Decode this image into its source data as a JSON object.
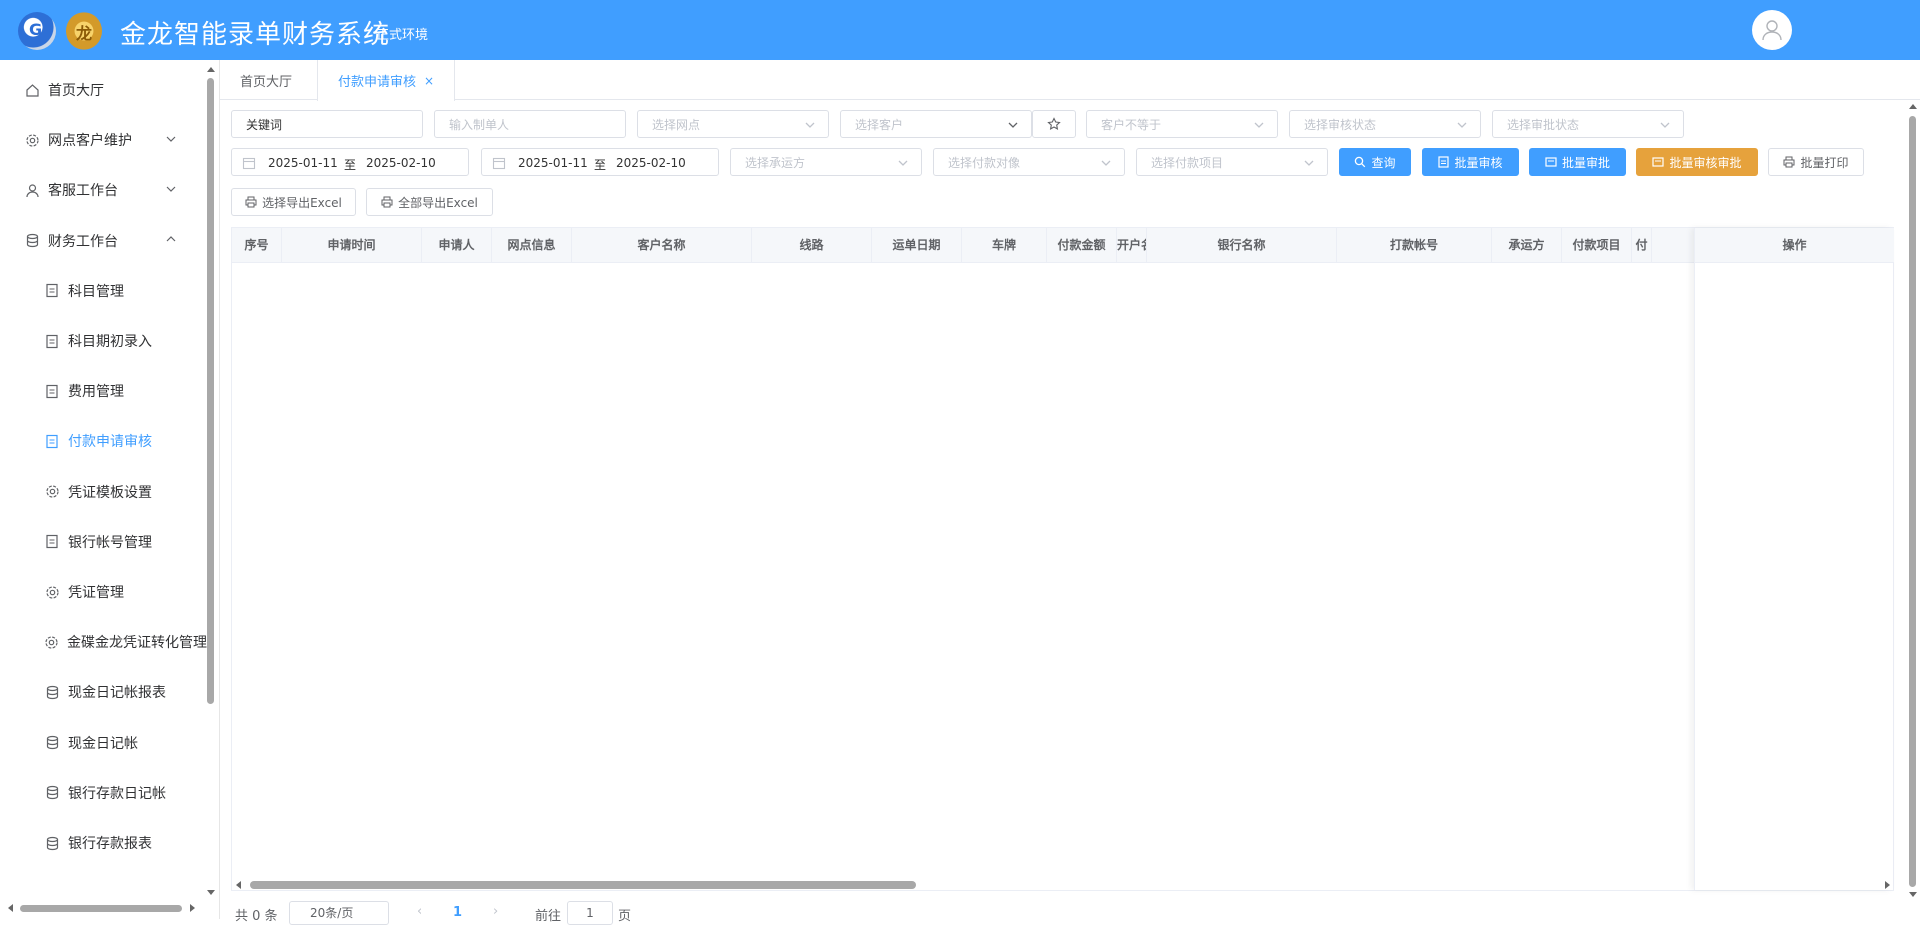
{
  "header": {
    "logo_text": "G",
    "logo2_text": "龙",
    "title": "金龙智能录单财务系统",
    "env": "正式环境"
  },
  "sidebar": {
    "items": [
      {
        "label": "首页大厅",
        "icon": "home-icon",
        "level": "top"
      },
      {
        "label": "网点客户维护",
        "icon": "gear-icon",
        "level": "top",
        "expandable": true,
        "expanded": false
      },
      {
        "label": "客服工作台",
        "icon": "user-icon",
        "level": "top",
        "expandable": true,
        "expanded": false
      },
      {
        "label": "财务工作台",
        "icon": "database-icon",
        "level": "top",
        "expandable": true,
        "expanded": true
      },
      {
        "label": "科目管理",
        "icon": "document-icon",
        "level": "sub"
      },
      {
        "label": "科目期初录入",
        "icon": "document-icon",
        "level": "sub"
      },
      {
        "label": "费用管理",
        "icon": "document-icon",
        "level": "sub"
      },
      {
        "label": "付款申请审核",
        "icon": "document-icon",
        "level": "sub",
        "active": true
      },
      {
        "label": "凭证模板设置",
        "icon": "gear-icon",
        "level": "sub"
      },
      {
        "label": "银行帐号管理",
        "icon": "document-icon",
        "level": "sub"
      },
      {
        "label": "凭证管理",
        "icon": "gear-icon",
        "level": "sub"
      },
      {
        "label": "金碟金龙凭证转化管理",
        "icon": "gear-icon",
        "level": "sub"
      },
      {
        "label": "现金日记帐报表",
        "icon": "database-icon",
        "level": "sub"
      },
      {
        "label": "现金日记帐",
        "icon": "database-icon",
        "level": "sub"
      },
      {
        "label": "银行存款日记帐",
        "icon": "database-icon",
        "level": "sub"
      },
      {
        "label": "银行存款报表",
        "icon": "database-icon",
        "level": "sub"
      }
    ]
  },
  "tabs": [
    {
      "label": "首页大厅",
      "active": false
    },
    {
      "label": "付款申请审核",
      "active": true,
      "close": "×"
    }
  ],
  "filters": {
    "keyword": {
      "value": "关键词"
    },
    "maker": {
      "placeholder": "输入制单人"
    },
    "branch": {
      "placeholder": "选择网点"
    },
    "customer": {
      "placeholder": "选择客户"
    },
    "customer_not_equal": {
      "placeholder": "客户不等于"
    },
    "audit_status": {
      "placeholder": "选择审核状态"
    },
    "approve_status": {
      "placeholder": "选择审批状态"
    },
    "date_range_1": {
      "start": "2025-01-11",
      "sep": "至",
      "end": "2025-02-10"
    },
    "date_range_2": {
      "start": "2025-01-11",
      "sep": "至",
      "end": "2025-02-10"
    },
    "carrier": {
      "placeholder": "选择承运方"
    },
    "pay_target": {
      "placeholder": "选择付款对像"
    },
    "pay_item": {
      "placeholder": "选择付款项目"
    }
  },
  "buttons": {
    "query": "查询",
    "batch_audit": "批量审核",
    "batch_approve": "批量审批",
    "batch_audit_approve": "批量审核审批",
    "batch_print": "批量打印",
    "export_selected": "选择导出Excel",
    "export_all": "全部导出Excel"
  },
  "table": {
    "columns": [
      "序号",
      "申请时间",
      "申请人",
      "网点信息",
      "客户名称",
      "线路",
      "运单日期",
      "车牌",
      "付款金额",
      "开户名",
      "银行名称",
      "打款帐号",
      "承运方",
      "付款项目",
      "付"
    ],
    "fixed_column": "操作",
    "rows": []
  },
  "pagination": {
    "total": "共 0 条",
    "page_size": "20条/页",
    "prev": "‹",
    "current": "1",
    "next": "›",
    "goto_prefix": "前往",
    "goto_value": "1",
    "goto_suffix": "页"
  },
  "colors": {
    "primary": "#409eff",
    "warning": "#e6a23c"
  }
}
